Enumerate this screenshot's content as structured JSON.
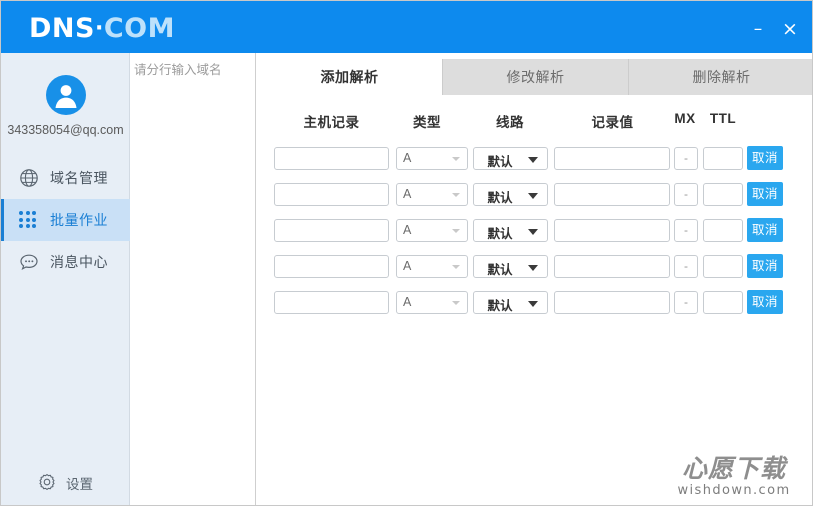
{
  "window": {
    "brand_main": "DNS",
    "brand_dot": "·",
    "brand_suffix": "COM",
    "minimize_label": "–",
    "close_label": "×",
    "header_color": "#0d8aee"
  },
  "sidebar": {
    "user_email": "343358054@qq.com",
    "items": [
      {
        "label": "域名管理",
        "icon": "globe-icon",
        "active": false
      },
      {
        "label": "批量作业",
        "icon": "grid-dots-icon",
        "active": true
      },
      {
        "label": "消息中心",
        "icon": "message-bubble-icon",
        "active": false
      }
    ],
    "settings": {
      "label": "设置",
      "icon": "gear-icon"
    },
    "active_color": "#1a7fd4",
    "active_bg": "#c9e0f6"
  },
  "domain_panel": {
    "placeholder": "请分行输入域名",
    "value": ""
  },
  "main": {
    "tabs": [
      {
        "label": "添加解析",
        "active": true
      },
      {
        "label": "修改解析",
        "active": false
      },
      {
        "label": "删除解析",
        "active": false
      }
    ],
    "columns": {
      "host": "主机记录",
      "type": "类型",
      "line": "线路",
      "value": "记录值",
      "mx": "MX",
      "ttl": "TTL"
    },
    "cancel_label": "取消",
    "cancel_color": "#2aa7ef",
    "mx_disabled_text": "-",
    "rows": [
      {
        "host": "",
        "type": "A",
        "line": "默认",
        "value": "",
        "mx": "-",
        "ttl": ""
      },
      {
        "host": "",
        "type": "A",
        "line": "默认",
        "value": "",
        "mx": "-",
        "ttl": ""
      },
      {
        "host": "",
        "type": "A",
        "line": "默认",
        "value": "",
        "mx": "-",
        "ttl": ""
      },
      {
        "host": "",
        "type": "A",
        "line": "默认",
        "value": "",
        "mx": "-",
        "ttl": ""
      },
      {
        "host": "",
        "type": "A",
        "line": "默认",
        "value": "",
        "mx": "-",
        "ttl": ""
      }
    ]
  },
  "watermark": {
    "cn": "心愿下载",
    "en": "wishdown.com"
  }
}
